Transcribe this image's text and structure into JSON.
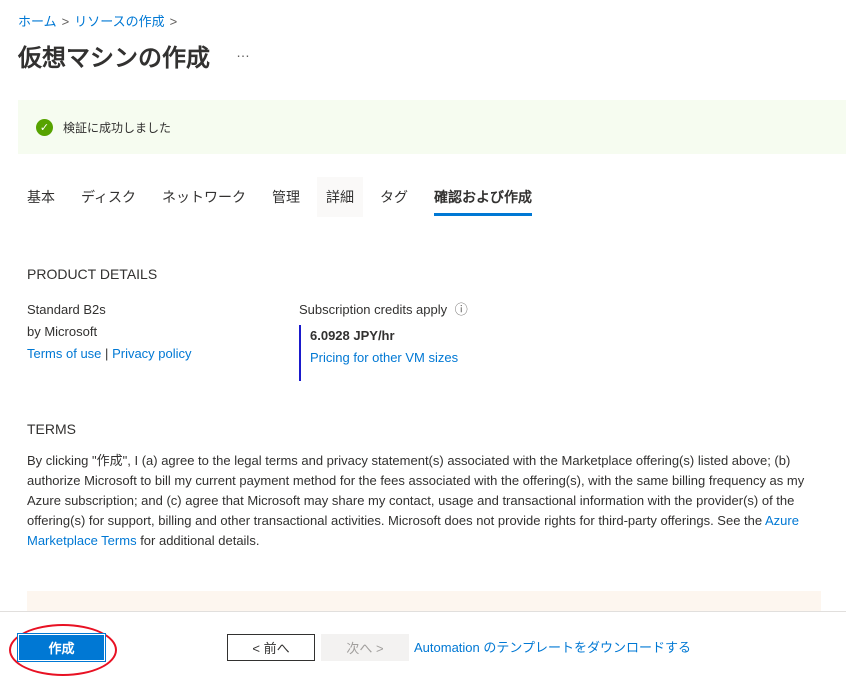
{
  "breadcrumb": [
    "ホーム",
    "リソースの作成"
  ],
  "title": "仮想マシンの作成",
  "more": "…",
  "banner": {
    "text": "検証に成功しました",
    "icon": "check-circle-icon"
  },
  "tabs": [
    "基本",
    "ディスク",
    "ネットワーク",
    "管理",
    "詳細",
    "タグ",
    "確認および作成"
  ],
  "product": {
    "heading": "PRODUCT DETAILS",
    "name": "Standard B2s",
    "publisher": "by Microsoft",
    "terms_link": "Terms of use",
    "sep": "|",
    "privacy_link": "Privacy policy",
    "credits": "Subscription credits apply",
    "info": "ⓘ",
    "price": "6.0928 JPY/hr",
    "pricing_link": "Pricing for other VM sizes"
  },
  "terms": {
    "heading": "TERMS",
    "text1": "By clicking \"作成\", I (a) agree to the legal terms and privacy statement(s) associated with the Marketplace offering(s) listed above; (b) authorize Microsoft to bill my current payment method for the fees associated with the offering(s), with the same billing frequency as my Azure subscription; and (c) agree that Microsoft may share my contact, usage and transactional information with the provider(s) of the offering(s) for support, billing and other transactional activities. Microsoft does not provide rights for third-party offerings. See the ",
    "link": "Azure Marketplace Terms",
    "text2": " for additional details."
  },
  "footer": {
    "create": "作成",
    "prev": "< 前へ",
    "next": "次へ >",
    "download": "Automation のテンプレートをダウンロードする"
  }
}
